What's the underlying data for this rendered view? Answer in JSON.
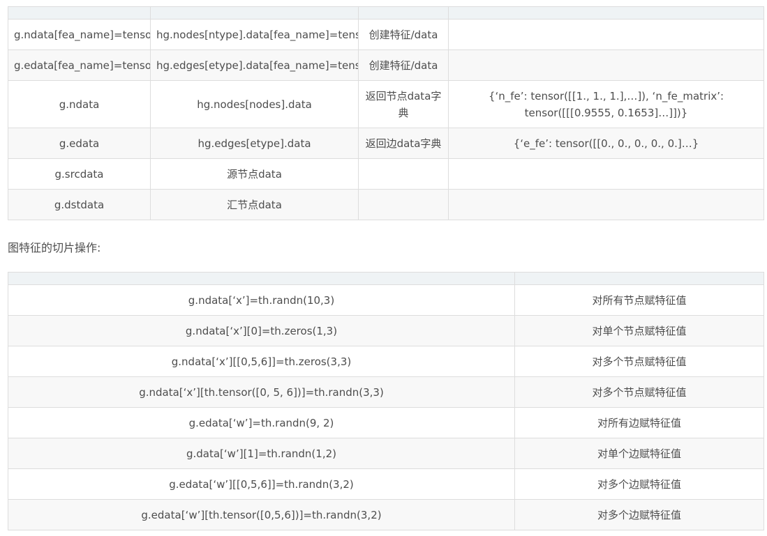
{
  "table_one": {
    "headers": [
      "",
      "",
      "",
      ""
    ],
    "rows": [
      [
        "g.ndata[fea_name]=tensor",
        "hg.nodes[ntype].data[fea_name]=tensor",
        "创建特征/data",
        ""
      ],
      [
        "g.edata[fea_name]=tensor",
        "hg.edges[etype].data[fea_name]=tensor",
        "创建特征/data",
        ""
      ],
      [
        "g.ndata",
        "hg.nodes[nodes].data",
        "返回节点data字典",
        "{‘n_fe’: tensor([[1., 1., 1.],…]), ‘n_fe_matrix’: tensor([[[0.9555, 0.1653]…]])}"
      ],
      [
        "g.edata",
        "hg.edges[etype].data",
        "返回边data字典",
        "{‘e_fe’: tensor([[0., 0., 0., 0., 0.]…}"
      ],
      [
        "g.srcdata",
        "源节点data",
        "",
        ""
      ],
      [
        "g.dstdata",
        "汇节点data",
        "",
        ""
      ]
    ]
  },
  "section_heading": "图特征的切片操作:",
  "table_two": {
    "headers": [
      "",
      ""
    ],
    "rows": [
      [
        "g.ndata[‘x’]=th.randn(10,3)",
        "对所有节点赋特征值"
      ],
      [
        "g.ndata[‘x’][0]=th.zeros(1,3)",
        "对单个节点赋特征值"
      ],
      [
        "g.ndata[‘x’][[0,5,6]]=th.zeros(3,3)",
        "对多个节点赋特征值"
      ],
      [
        "g.ndata[‘x’][th.tensor([0, 5, 6])]=th.randn(3,3)",
        "对多个节点赋特征值"
      ],
      [
        "g.edata[‘w’]=th.randn(9, 2)",
        "对所有边赋特征值"
      ],
      [
        "g.data[‘w’][1]=th.randn(1,2)",
        "对单个边赋特征值"
      ],
      [
        "g.edata[‘w’][[0,5,6]]=th.randn(3,2)",
        "对多个边赋特征值"
      ],
      [
        "g.edata[‘w’][th.tensor([0,5,6])]=th.randn(3,2)",
        "对多个边赋特征值"
      ]
    ]
  }
}
